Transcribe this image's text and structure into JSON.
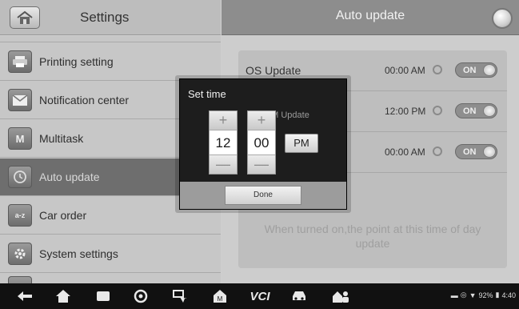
{
  "header": {
    "title": "Settings",
    "right_title": "Auto update"
  },
  "sidebar": {
    "items": [
      {
        "label": "",
        "icon": "partial-icon"
      },
      {
        "label": "Printing setting",
        "icon": "printer-icon"
      },
      {
        "label": "Notification center",
        "icon": "envelope-icon"
      },
      {
        "label": "Multitask",
        "icon": "multitask-icon"
      },
      {
        "label": "Auto update",
        "icon": "clock-icon",
        "selected": true
      },
      {
        "label": "Car order",
        "icon": "car-order-icon"
      },
      {
        "label": "System settings",
        "icon": "gear-icon"
      }
    ]
  },
  "updates": [
    {
      "label": "OS Update",
      "time": "00:00 AM",
      "toggle": "ON"
    },
    {
      "label": "",
      "time": "12:00 PM",
      "toggle": "ON"
    },
    {
      "label": "",
      "time": "00:00 AM",
      "toggle": "ON"
    }
  ],
  "note": "When turned on,the point at this time of day update",
  "dialog": {
    "title": "Set time",
    "hour": "12",
    "minute": "00",
    "ampm": "PM",
    "plus": "+",
    "minus": "—",
    "done": "Done",
    "ghost_text": "pM Update"
  },
  "statusbar": {
    "battery": "92%",
    "time": "4:40",
    "vci_label": "VCI"
  },
  "colors": {
    "header_right": "#8d8d8d",
    "selected_item": "#6e6e6e",
    "dialog_bg": "#1d1d1d",
    "navbar": "#111111"
  }
}
